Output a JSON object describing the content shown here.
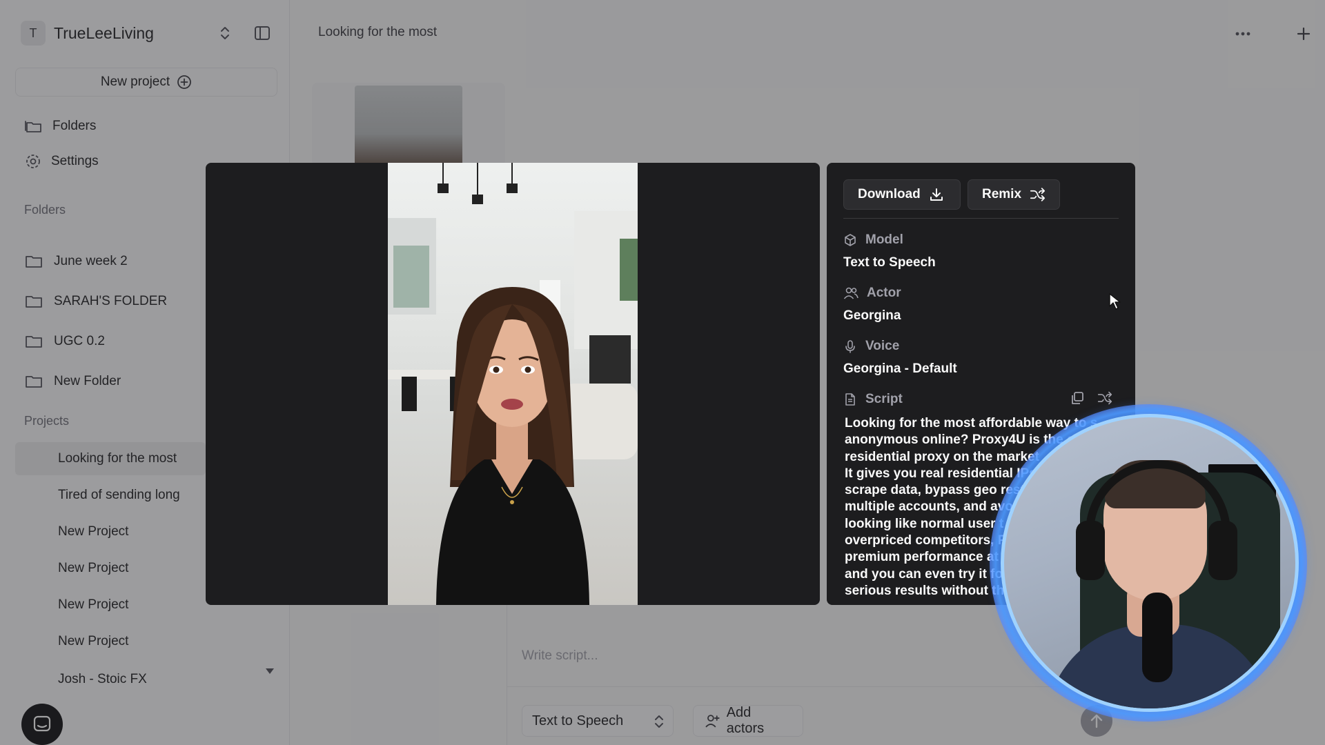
{
  "workspace": {
    "initial": "T",
    "name": "TrueLeeLiving"
  },
  "sidebar": {
    "new_project_label": "New project",
    "nav": [
      {
        "label": "Folders",
        "icon": "folder-stack-icon"
      },
      {
        "label": "Settings",
        "icon": "gear-icon"
      }
    ],
    "folders_heading": "Folders",
    "folders": [
      {
        "label": "June week 2"
      },
      {
        "label": "SARAH'S FOLDER"
      },
      {
        "label": "UGC 0.2"
      },
      {
        "label": "New Folder"
      }
    ],
    "projects_heading": "Projects",
    "projects": [
      {
        "label": "Looking for the most",
        "active": true
      },
      {
        "label": "Tired of sending long"
      },
      {
        "label": "New Project"
      },
      {
        "label": "New Project"
      },
      {
        "label": "New Project"
      },
      {
        "label": "New Project"
      },
      {
        "label": "Josh - Stoic FX"
      }
    ]
  },
  "main": {
    "title": "Looking for the most",
    "composer": {
      "placeholder": "Write script...",
      "model_select": "Text to Speech",
      "add_actors_label": "Add actors"
    }
  },
  "modal": {
    "download_label": "Download",
    "remix_label": "Remix",
    "fields": {
      "model_label": "Model",
      "model_value": "Text to Speech",
      "actor_label": "Actor",
      "actor_value": "Georgina",
      "voice_label": "Voice",
      "voice_value": "Georgina - Default",
      "script_label": "Script"
    },
    "script_lines": [
      "Looking for the most affordable way to s",
      "anonymous online? Proxy4U is the c",
      "residential proxy on the market",
      "It gives you real residential IPs",
      "scrape data, bypass geo rest",
      "multiple accounts, and avo",
      "looking like normal user t",
      "overpriced competitors, P",
      "premium performance at",
      "and you can even try it fo",
      "serious results without th"
    ]
  },
  "colors": {
    "modal_bg": "#1d1d1f",
    "sidebar_bg": "#f7f7f8",
    "webcam_ring": "#4a90ff"
  }
}
